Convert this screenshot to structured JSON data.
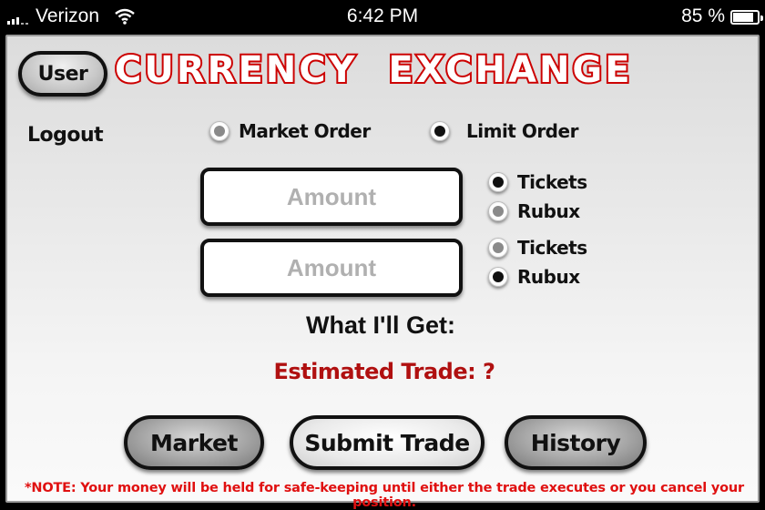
{
  "status_bar": {
    "carrier": "Verizon",
    "time": "6:42 PM",
    "battery_percent_label": "85 %",
    "battery_level": 0.85,
    "icons": [
      "signal-bars-icon",
      "wifi-icon",
      "battery-icon"
    ]
  },
  "header": {
    "user_button": "User",
    "title": "CURRENCY  EXCHANGE",
    "logout": "Logout"
  },
  "order_type": {
    "options": [
      {
        "label": "Market Order",
        "selected": false
      },
      {
        "label": "Limit Order",
        "selected": true
      }
    ]
  },
  "inputs": [
    {
      "placeholder": "Amount",
      "value": "",
      "currency_options": [
        {
          "label": "Tickets",
          "selected": true
        },
        {
          "label": "Rubux",
          "selected": false
        }
      ]
    },
    {
      "placeholder": "Amount",
      "value": "",
      "currency_options": [
        {
          "label": "Tickets",
          "selected": false
        },
        {
          "label": "Rubux",
          "selected": true
        }
      ]
    }
  ],
  "result": {
    "heading": "What I'll Get:",
    "estimate": "Estimated Trade: ?"
  },
  "buttons": {
    "market": "Market",
    "submit": "Submit Trade",
    "history": "History"
  },
  "note": "*NOTE: Your money will be held for safe-keeping until either the trade executes or you cancel your position.",
  "colors": {
    "title_red": "#cc0000",
    "estimate_red": "#b01010",
    "note_red": "#e01010"
  }
}
